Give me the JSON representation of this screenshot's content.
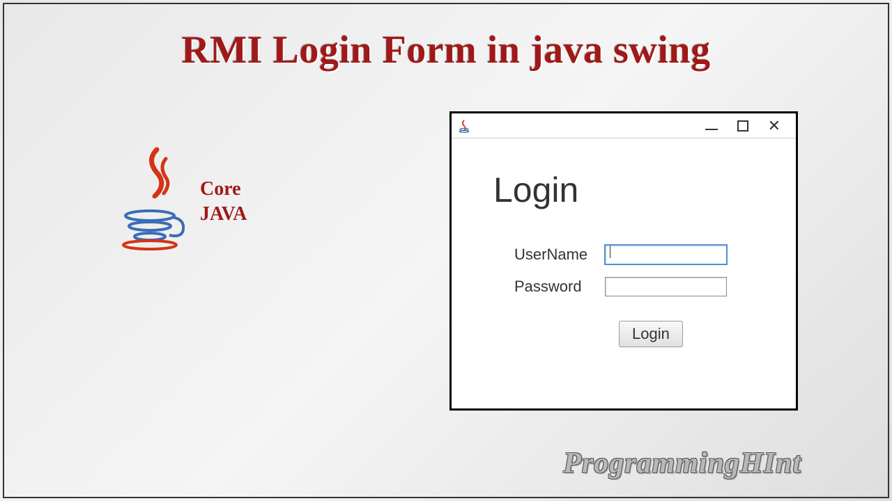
{
  "title": "RMI Login Form in java swing",
  "logo": {
    "line1": "Core",
    "line2": "JAVA"
  },
  "window": {
    "heading": "Login",
    "username_label": "UserName",
    "username_value": "",
    "password_label": "Password",
    "password_value": "",
    "login_button_label": "Login"
  },
  "footer": "ProgrammingHInt"
}
